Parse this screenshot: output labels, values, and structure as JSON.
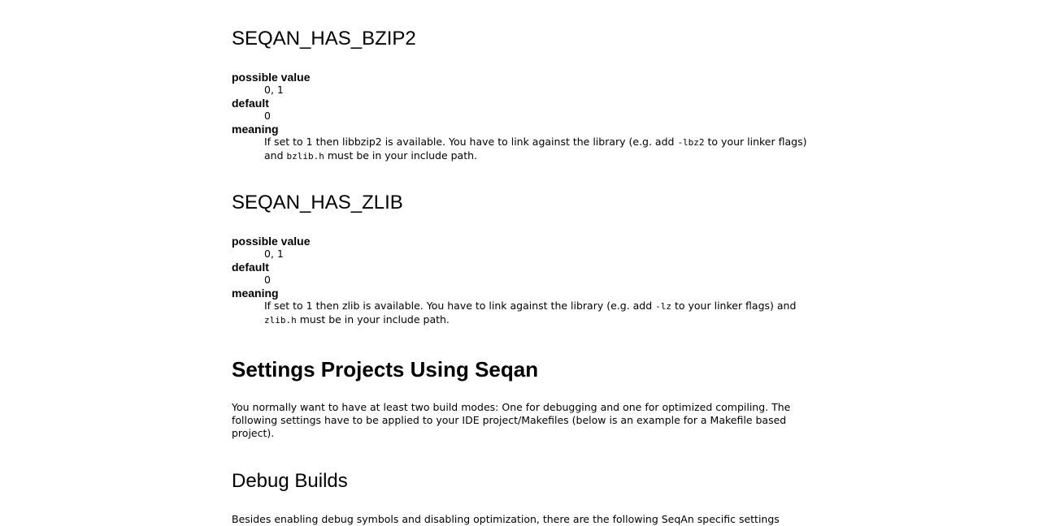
{
  "sections": {
    "bzip2": {
      "title": "SEQAN_HAS_BZIP2",
      "possible_value_label": "possible value",
      "possible_value": "0, 1",
      "default_label": "default",
      "default": "0",
      "meaning_label": "meaning",
      "meaning_part1": "If set to 1 then libbzip2 is available. You have to link against the library (e.g. add ",
      "meaning_code1": "-lbz2",
      "meaning_part2": " to your linker flags) and ",
      "meaning_code2": "bzlib.h",
      "meaning_part3": " must be in your include path."
    },
    "zlib": {
      "title": "SEQAN_HAS_ZLIB",
      "possible_value_label": "possible value",
      "possible_value": "0, 1",
      "default_label": "default",
      "default": "0",
      "meaning_label": "meaning",
      "meaning_part1": "If set to 1 then zlib is available. You have to link against the library (e.g. add ",
      "meaning_code1": "-lz",
      "meaning_part2": " to your linker flags) and ",
      "meaning_code2": "zlib.h",
      "meaning_part3": " must be in your include path."
    },
    "settings_projects": {
      "title": "Settings Projects Using Seqan",
      "paragraph": "You normally want to have at least two build modes: One for debugging and one for optimized compiling. The following settings have to be applied to your IDE project/Makefiles (below is an example for a Makefile based project)."
    },
    "debug_builds": {
      "title": "Debug Builds",
      "paragraph": "Besides enabling debug symbols and disabling optimization, there are the following SeqAn specific settings"
    }
  }
}
